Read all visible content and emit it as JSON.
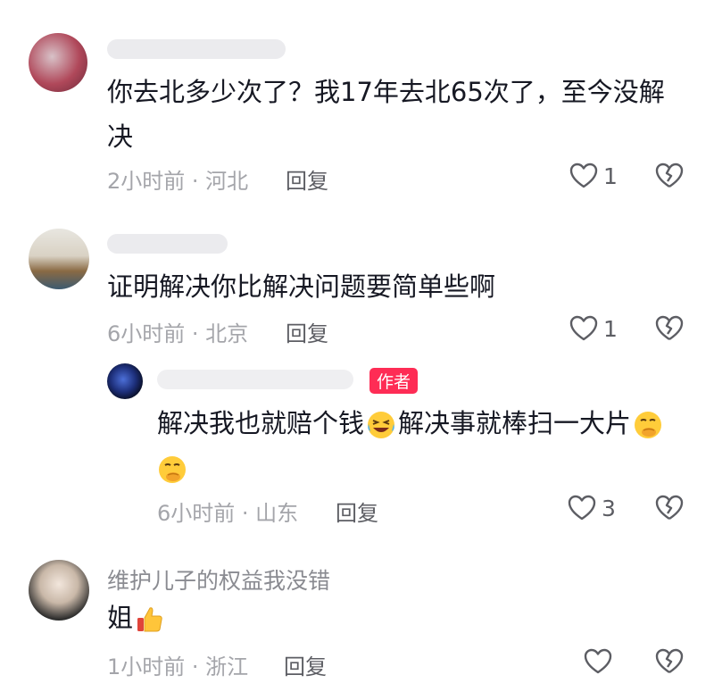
{
  "comments": [
    {
      "text_line1": "你去北多少次了？我17年去北65次了，至今没解",
      "text_line2": "决",
      "time": "2小时前",
      "location": "河北",
      "reply_label": "回复",
      "like_count": "1"
    },
    {
      "text_line1": "证明解决你比解决问题要简单些啊",
      "time": "6小时前",
      "location": "北京",
      "reply_label": "回复",
      "like_count": "1"
    },
    {
      "author_badge": "作者",
      "text_part1": "解决我也就赔个钱",
      "text_part2": "解决事就棒扫一大片",
      "time": "6小时前",
      "location": "山东",
      "reply_label": "回复",
      "like_count": "3"
    },
    {
      "username": "维护儿子的权益我没错",
      "text": "姐",
      "time": "1小时前",
      "location": "浙江",
      "reply_label": "回复"
    }
  ],
  "meta_separator": " · ",
  "colors": {
    "accent": "#fe2c55",
    "text": "#161823",
    "muted": "#a4a5aa"
  },
  "icons": [
    "heart-icon",
    "broken-heart-icon",
    "laughing-crying-emoji",
    "smirking-hand-emoji",
    "thumbs-up-emoji"
  ]
}
